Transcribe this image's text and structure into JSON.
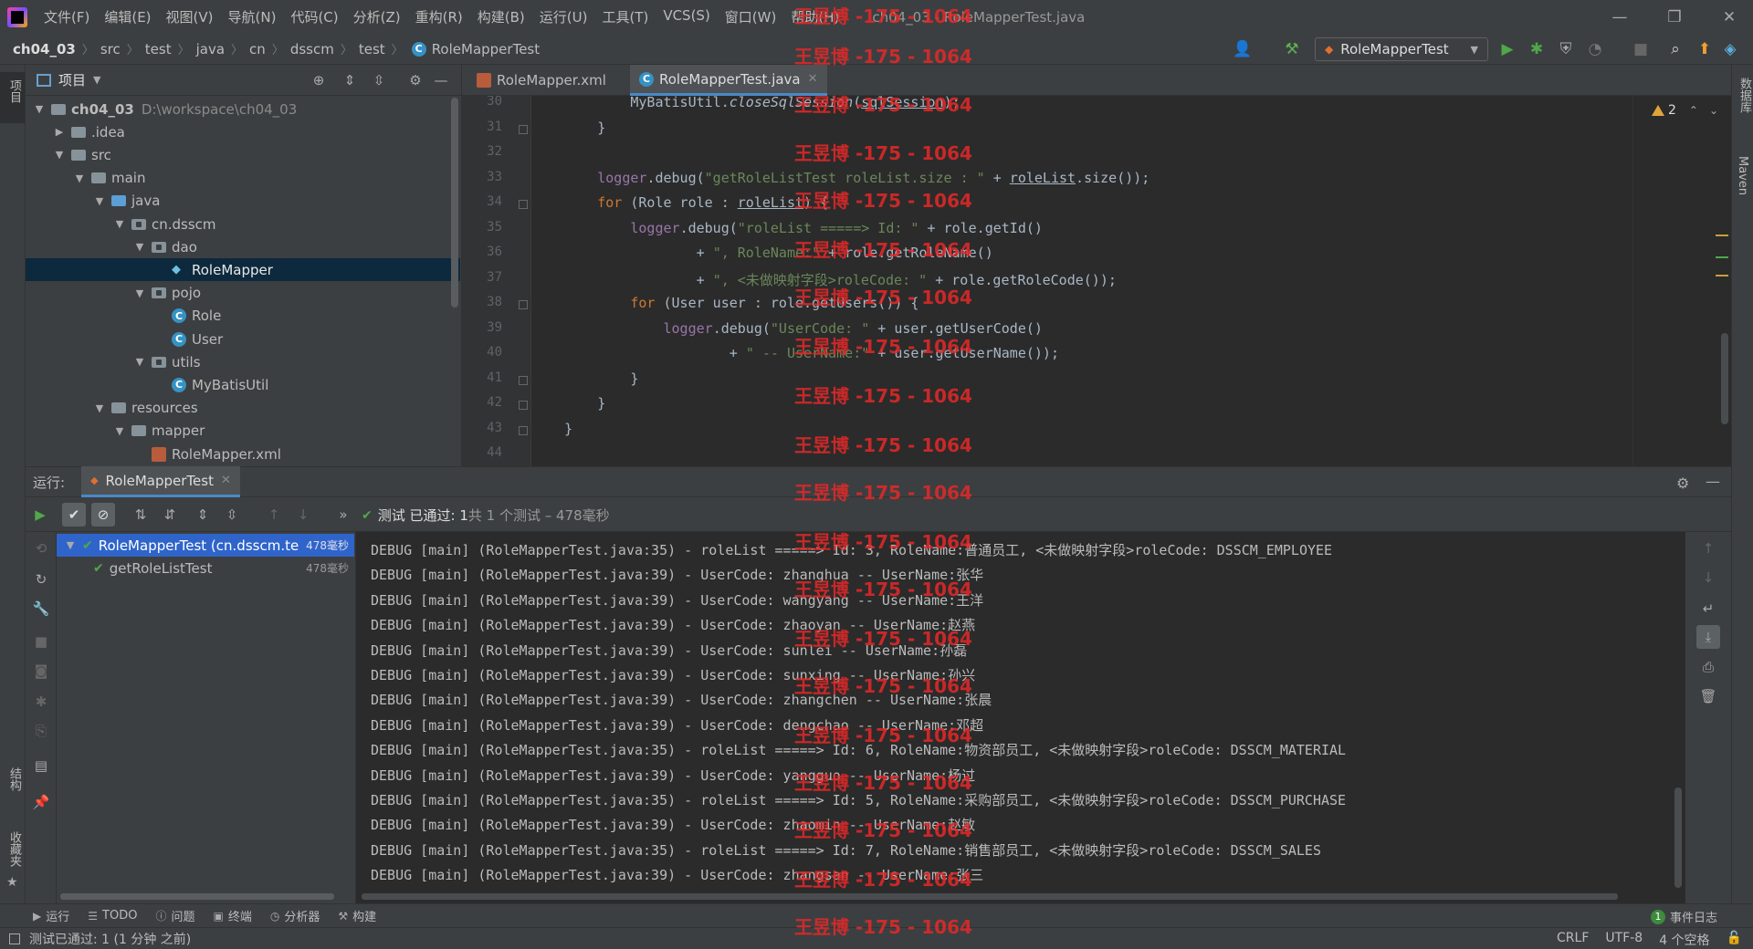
{
  "menubar": {
    "items": [
      "文件(F)",
      "编辑(E)",
      "视图(V)",
      "导航(N)",
      "代码(C)",
      "分析(Z)",
      "重构(R)",
      "构建(B)",
      "运行(U)",
      "工具(T)",
      "VCS(S)",
      "窗口(W)",
      "帮助(H)"
    ],
    "window_title": "ch04_03 - RoleMapperTest.java"
  },
  "breadcrumbs": [
    "ch04_03",
    "src",
    "test",
    "java",
    "cn",
    "dsscm",
    "test",
    "RoleMapperTest"
  ],
  "run_config": "RoleMapperTest",
  "left_strip_label": "项目",
  "left_strip_labels_bottom": [
    "结构",
    "收藏夹"
  ],
  "right_strip_labels": [
    "数据库",
    "Maven"
  ],
  "project": {
    "title": "项目",
    "tree": [
      {
        "label": "ch04_03",
        "hint": "D:\\workspace\\ch04_03",
        "depth": 0,
        "type": "module",
        "open": true
      },
      {
        "label": ".idea",
        "depth": 1,
        "type": "folder",
        "open": false
      },
      {
        "label": "src",
        "depth": 1,
        "type": "folder",
        "open": true
      },
      {
        "label": "main",
        "depth": 2,
        "type": "folder",
        "open": true
      },
      {
        "label": "java",
        "depth": 3,
        "type": "folder-blue",
        "open": true
      },
      {
        "label": "cn.dsscm",
        "depth": 4,
        "type": "package",
        "open": true
      },
      {
        "label": "dao",
        "depth": 5,
        "type": "package",
        "open": true
      },
      {
        "label": "RoleMapper",
        "depth": 6,
        "type": "interface",
        "selected": true
      },
      {
        "label": "pojo",
        "depth": 5,
        "type": "package",
        "open": true
      },
      {
        "label": "Role",
        "depth": 6,
        "type": "class"
      },
      {
        "label": "User",
        "depth": 6,
        "type": "class"
      },
      {
        "label": "utils",
        "depth": 5,
        "type": "package",
        "open": true
      },
      {
        "label": "MyBatisUtil",
        "depth": 6,
        "type": "class"
      },
      {
        "label": "resources",
        "depth": 3,
        "type": "folder",
        "open": true
      },
      {
        "label": "mapper",
        "depth": 4,
        "type": "folder",
        "open": true
      },
      {
        "label": "RoleMapper.xml",
        "depth": 5,
        "type": "xml"
      }
    ]
  },
  "editor": {
    "tabs": [
      {
        "label": "RoleMapper.xml",
        "active": false
      },
      {
        "label": "RoleMapperTest.java",
        "active": true
      }
    ],
    "warnings": "2",
    "lines": [
      {
        "n": "30",
        "html": "            MyBatisUtil.<span class=\"itl\">closeSqlSession</span>(<span class=\"und\">sqlSession</span>);"
      },
      {
        "n": "31",
        "html": "        }"
      },
      {
        "n": "32",
        "html": ""
      },
      {
        "n": "33",
        "html": "        <span class=\"fld\">logger</span>.debug(<span class=\"str\">\"getRoleListTest roleList.size : \"</span> + <span class=\"und\">roleList</span>.size());"
      },
      {
        "n": "34",
        "html": "        <span class=\"kw\">for</span> (Role role : <span class=\"und\">roleList</span>) {"
      },
      {
        "n": "35",
        "html": "            <span class=\"fld\">logger</span>.debug(<span class=\"str\">\"roleList =====&gt; Id: \"</span> + role.getId()"
      },
      {
        "n": "36",
        "html": "                    + <span class=\"str\">\", RoleName:\"</span> + role.getRoleName()"
      },
      {
        "n": "37",
        "html": "                    + <span class=\"str\">\", &lt;未做映射字段&gt;roleCode: \"</span> + role.getRoleCode());"
      },
      {
        "n": "38",
        "html": "            <span class=\"kw\">for</span> (User user : role.getUsers()) {"
      },
      {
        "n": "39",
        "html": "                <span class=\"fld\">logger</span>.debug(<span class=\"str\">\"UserCode: \"</span> + user.getUserCode()"
      },
      {
        "n": "40",
        "html": "                        + <span class=\"str\">\" -- UserName:\"</span> + user.getUserName());"
      },
      {
        "n": "41",
        "html": "            }"
      },
      {
        "n": "42",
        "html": "        }"
      },
      {
        "n": "43",
        "html": "    }"
      },
      {
        "n": "44",
        "html": ""
      }
    ]
  },
  "run_panel": {
    "label": "运行:",
    "tab": "RoleMapperTest",
    "status_prefix": "测试 已通过: 1",
    "status_detail": "共 1 个测试 – 478毫秒",
    "tests": [
      {
        "label": "RoleMapperTest (cn.dsscm.te",
        "time": "478毫秒",
        "selected": true,
        "depth": 0
      },
      {
        "label": "getRoleListTest",
        "time": "478毫秒",
        "selected": false,
        "depth": 1
      }
    ],
    "console": [
      "DEBUG [main] (RoleMapperTest.java:35) - roleList =====> Id: 3, RoleName:普通员工, <未做映射字段>roleCode: DSSCM_EMPLOYEE",
      "DEBUG [main] (RoleMapperTest.java:39) - UserCode: zhanghua -- UserName:张华",
      "DEBUG [main] (RoleMapperTest.java:39) - UserCode: wangyang -- UserName:王洋",
      "DEBUG [main] (RoleMapperTest.java:39) - UserCode: zhaoyan -- UserName:赵燕",
      "DEBUG [main] (RoleMapperTest.java:39) - UserCode: sunlei -- UserName:孙磊",
      "DEBUG [main] (RoleMapperTest.java:39) - UserCode: sunxing -- UserName:孙兴",
      "DEBUG [main] (RoleMapperTest.java:39) - UserCode: zhangchen -- UserName:张晨",
      "DEBUG [main] (RoleMapperTest.java:39) - UserCode: dengchao -- UserName:邓超",
      "DEBUG [main] (RoleMapperTest.java:35) - roleList =====> Id: 6, RoleName:物资部员工, <未做映射字段>roleCode: DSSCM_MATERIAL",
      "DEBUG [main] (RoleMapperTest.java:39) - UserCode: yangguo -- UserName:杨过",
      "DEBUG [main] (RoleMapperTest.java:35) - roleList =====> Id: 5, RoleName:采购部员工, <未做映射字段>roleCode: DSSCM_PURCHASE",
      "DEBUG [main] (RoleMapperTest.java:39) - UserCode: zhaomin -- UserName:赵敏",
      "DEBUG [main] (RoleMapperTest.java:35) - roleList =====> Id: 7, RoleName:销售部员工, <未做映射字段>roleCode: DSSCM_SALES",
      "DEBUG [main] (RoleMapperTest.java:39) - UserCode: zhangsan -- UserName:张三"
    ]
  },
  "bottom_tools": [
    {
      "label": "运行",
      "icon": "play-icon"
    },
    {
      "label": "TODO",
      "icon": "list-icon"
    },
    {
      "label": "问题",
      "icon": "info-icon"
    },
    {
      "label": "终端",
      "icon": "terminal-icon"
    },
    {
      "label": "分析器",
      "icon": "profiler-icon"
    },
    {
      "label": "构建",
      "icon": "hammer-icon"
    }
  ],
  "event_log": {
    "count": "1",
    "label": "事件日志"
  },
  "statusbar": {
    "message": "测试已通过: 1 (1 分钟 之前)",
    "line_sep": "CRLF",
    "encoding": "UTF-8",
    "indent": "4 个空格"
  },
  "watermark": "王昱博 -175 - 1064",
  "colors": {
    "accent": "#4a88c7",
    "selection": "#2f65ca",
    "pass": "#4fa84a",
    "watermark": "#e62828"
  }
}
